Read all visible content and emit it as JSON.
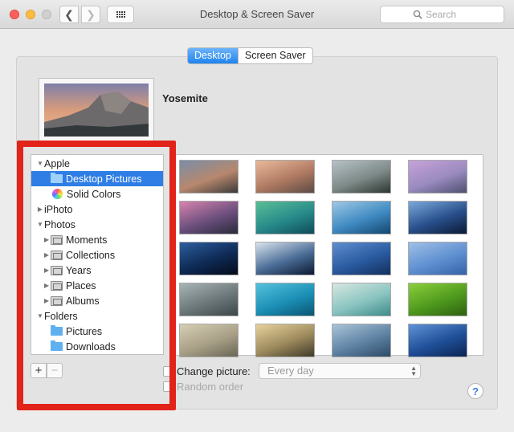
{
  "window": {
    "title": "Desktop & Screen Saver"
  },
  "toolbar": {
    "back_glyph": "❮",
    "forward_glyph": "❯",
    "search_placeholder": "Search"
  },
  "tabs": [
    {
      "label": "Desktop",
      "active": true
    },
    {
      "label": "Screen Saver",
      "active": false
    }
  ],
  "preview": {
    "name": "Yosemite"
  },
  "sidebar": {
    "rows": [
      {
        "label": "Apple",
        "disclosure": "▼",
        "icon": "none",
        "selected": false
      },
      {
        "label": "Desktop Pictures",
        "disclosure": "",
        "icon": "folder-icon",
        "selected": true
      },
      {
        "label": "Solid Colors",
        "disclosure": "",
        "icon": "color-wheel-icon",
        "selected": false
      },
      {
        "label": "iPhoto",
        "disclosure": "▶",
        "icon": "none",
        "selected": false
      },
      {
        "label": "Photos",
        "disclosure": "▼",
        "icon": "none",
        "selected": false
      },
      {
        "label": "Moments",
        "disclosure": "▶",
        "icon": "photo-folder-icon",
        "selected": false
      },
      {
        "label": "Collections",
        "disclosure": "▶",
        "icon": "photo-folder-icon",
        "selected": false
      },
      {
        "label": "Years",
        "disclosure": "▶",
        "icon": "photo-folder-icon",
        "selected": false
      },
      {
        "label": "Places",
        "disclosure": "▶",
        "icon": "photo-folder-icon",
        "selected": false
      },
      {
        "label": "Albums",
        "disclosure": "▶",
        "icon": "photo-folder-icon",
        "selected": false
      },
      {
        "label": "Folders",
        "disclosure": "▼",
        "icon": "none",
        "selected": false
      },
      {
        "label": "Pictures",
        "disclosure": "",
        "icon": "folder-icon",
        "selected": false
      },
      {
        "label": "Downloads",
        "disclosure": "",
        "icon": "folder-icon",
        "selected": false
      }
    ]
  },
  "buttons": {
    "add": "+",
    "remove": "−",
    "help": "?"
  },
  "options": {
    "change_picture_label": "Change picture:",
    "change_picture_value": "Every day",
    "random_order_label": "Random order"
  },
  "thumbnails": [
    {
      "name": "yosemite-half-dome",
      "colors": [
        "#7a8da8",
        "#b7886d",
        "#3c3a3a"
      ]
    },
    {
      "name": "yosemite-el-capitan",
      "colors": [
        "#e9b99b",
        "#b07a62",
        "#5b4a43"
      ]
    },
    {
      "name": "yosemite-forest-fog",
      "colors": [
        "#b7c2c7",
        "#7d8a88",
        "#2e3630"
      ]
    },
    {
      "name": "yosemite-pink-dusk",
      "colors": [
        "#c7a2d8",
        "#9a8bc0",
        "#4f506f"
      ]
    },
    {
      "name": "lake-pink-rocks",
      "colors": [
        "#d883b0",
        "#6b4f7c",
        "#2a2a3c"
      ]
    },
    {
      "name": "green-wave",
      "colors": [
        "#5bbf96",
        "#278a8a",
        "#0f4b5a"
      ]
    },
    {
      "name": "blue-wave",
      "colors": [
        "#9fc8e4",
        "#3f8ac2",
        "#14466f"
      ]
    },
    {
      "name": "galaxy",
      "colors": [
        "#7ba9db",
        "#284f8b",
        "#0b1a33"
      ]
    },
    {
      "name": "earth-horizon",
      "colors": [
        "#2d5e9e",
        "#0e2a55",
        "#050b1a"
      ]
    },
    {
      "name": "earth-from-space",
      "colors": [
        "#d8e4ee",
        "#4a6c96",
        "#0b1a33"
      ]
    },
    {
      "name": "blue-abstract-circle",
      "colors": [
        "#5f8fcf",
        "#2a5aa0",
        "#13305d"
      ]
    },
    {
      "name": "blue-moon-sky",
      "colors": [
        "#9fc0e8",
        "#5e8fd0",
        "#3661a8"
      ]
    },
    {
      "name": "storm-clouds",
      "colors": [
        "#a8b4b6",
        "#6b7779",
        "#3d4648"
      ]
    },
    {
      "name": "turquoise-sand",
      "colors": [
        "#54c2dd",
        "#1b8fb5",
        "#0b5474"
      ]
    },
    {
      "name": "beach-shore",
      "colors": [
        "#d8e7e0",
        "#8ac4c0",
        "#3f8a8a"
      ]
    },
    {
      "name": "green-fields",
      "colors": [
        "#8ccf3c",
        "#4f9a1d",
        "#2e5f12"
      ]
    },
    {
      "name": "foggy-valley",
      "colors": [
        "#d6cfb4",
        "#a89f86",
        "#6a6656"
      ]
    },
    {
      "name": "forest-light-rays",
      "colors": [
        "#e7d29c",
        "#9d8a5d",
        "#3f3a2a"
      ]
    },
    {
      "name": "misty-mountains",
      "colors": [
        "#a9c4d8",
        "#5e82a3",
        "#2e4a66"
      ]
    },
    {
      "name": "blue-night-sky",
      "colors": [
        "#5f93d6",
        "#1f4f98",
        "#0c2452"
      ]
    }
  ]
}
